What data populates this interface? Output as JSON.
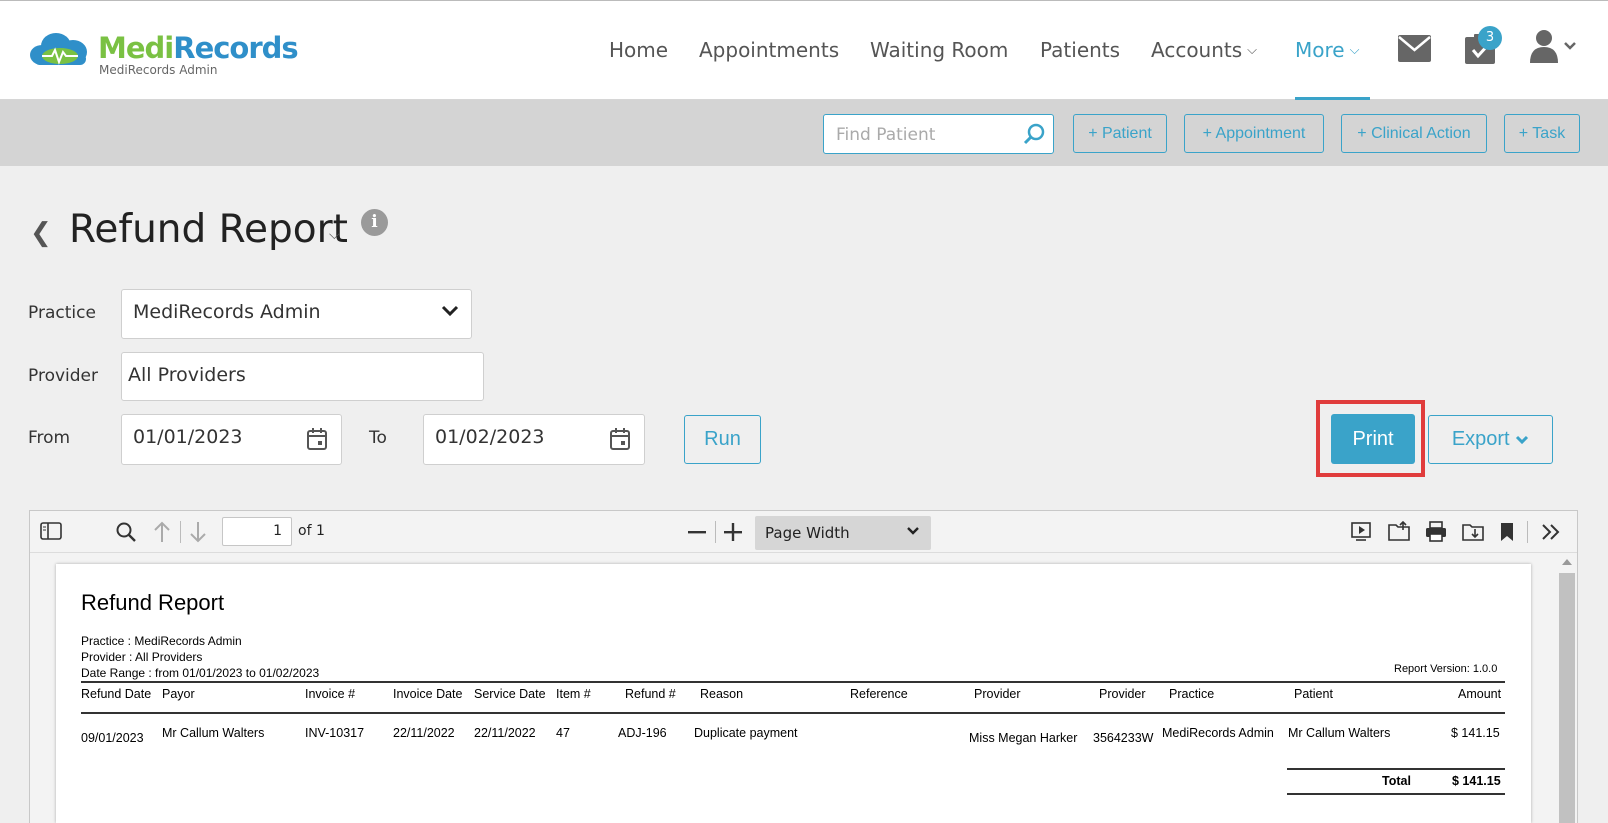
{
  "header": {
    "logo_part1": "Medi",
    "logo_part2": "Records",
    "logo_sub": "MediRecords Admin",
    "nav": [
      "Home",
      "Appointments",
      "Waiting Room",
      "Patients",
      "Accounts",
      "More"
    ],
    "tasks_badge": "3"
  },
  "subbar": {
    "find_placeholder": "Find Patient",
    "btn_patient": "+ Patient",
    "btn_appointment": "+ Appointment",
    "btn_clinical": "+ Clinical Action",
    "btn_task": "+ Task"
  },
  "page": {
    "title": "Refund Report"
  },
  "form": {
    "practice_label": "Practice",
    "practice_value": "MediRecords Admin",
    "provider_label": "Provider",
    "provider_value": "All Providers",
    "from_label": "From",
    "from_value": "01/01/2023",
    "to_label": "To",
    "to_value": "01/02/2023",
    "run_label": "Run",
    "print_label": "Print",
    "export_label": "Export"
  },
  "viewer": {
    "page_number": "1",
    "page_of": "of 1",
    "zoom": "Page Width"
  },
  "report": {
    "title": "Refund Report",
    "practice_line": "Practice : MediRecords Admin",
    "provider_line": "Provider : All Providers",
    "range_line": "Date Range : from 01/01/2023 to 01/02/2023",
    "version": "Report Version: 1.0.0",
    "columns": [
      "Refund Date",
      "Payor",
      "Invoice #",
      "Invoice Date",
      "Service Date",
      "Item #",
      "Refund #",
      "Reason",
      "Reference",
      "Provider",
      "Provider",
      "Practice",
      "Patient",
      "Amount"
    ],
    "rows": [
      [
        "09/01/2023",
        "Mr Callum Walters",
        "INV-10317",
        "22/11/2022",
        "22/11/2022",
        "47",
        "ADJ-196",
        "Duplicate payment",
        "",
        "Miss Megan Harker",
        "3564233W",
        "MediRecords Admin",
        "Mr Callum Walters",
        "$ 141.15"
      ]
    ],
    "total_label": "Total",
    "total_value": "$ 141.15"
  },
  "colors": {
    "accent": "#3aa3c9",
    "highlight": "#e03c3c",
    "logo_green": "#7ac143",
    "logo_blue": "#2f8fc9"
  }
}
